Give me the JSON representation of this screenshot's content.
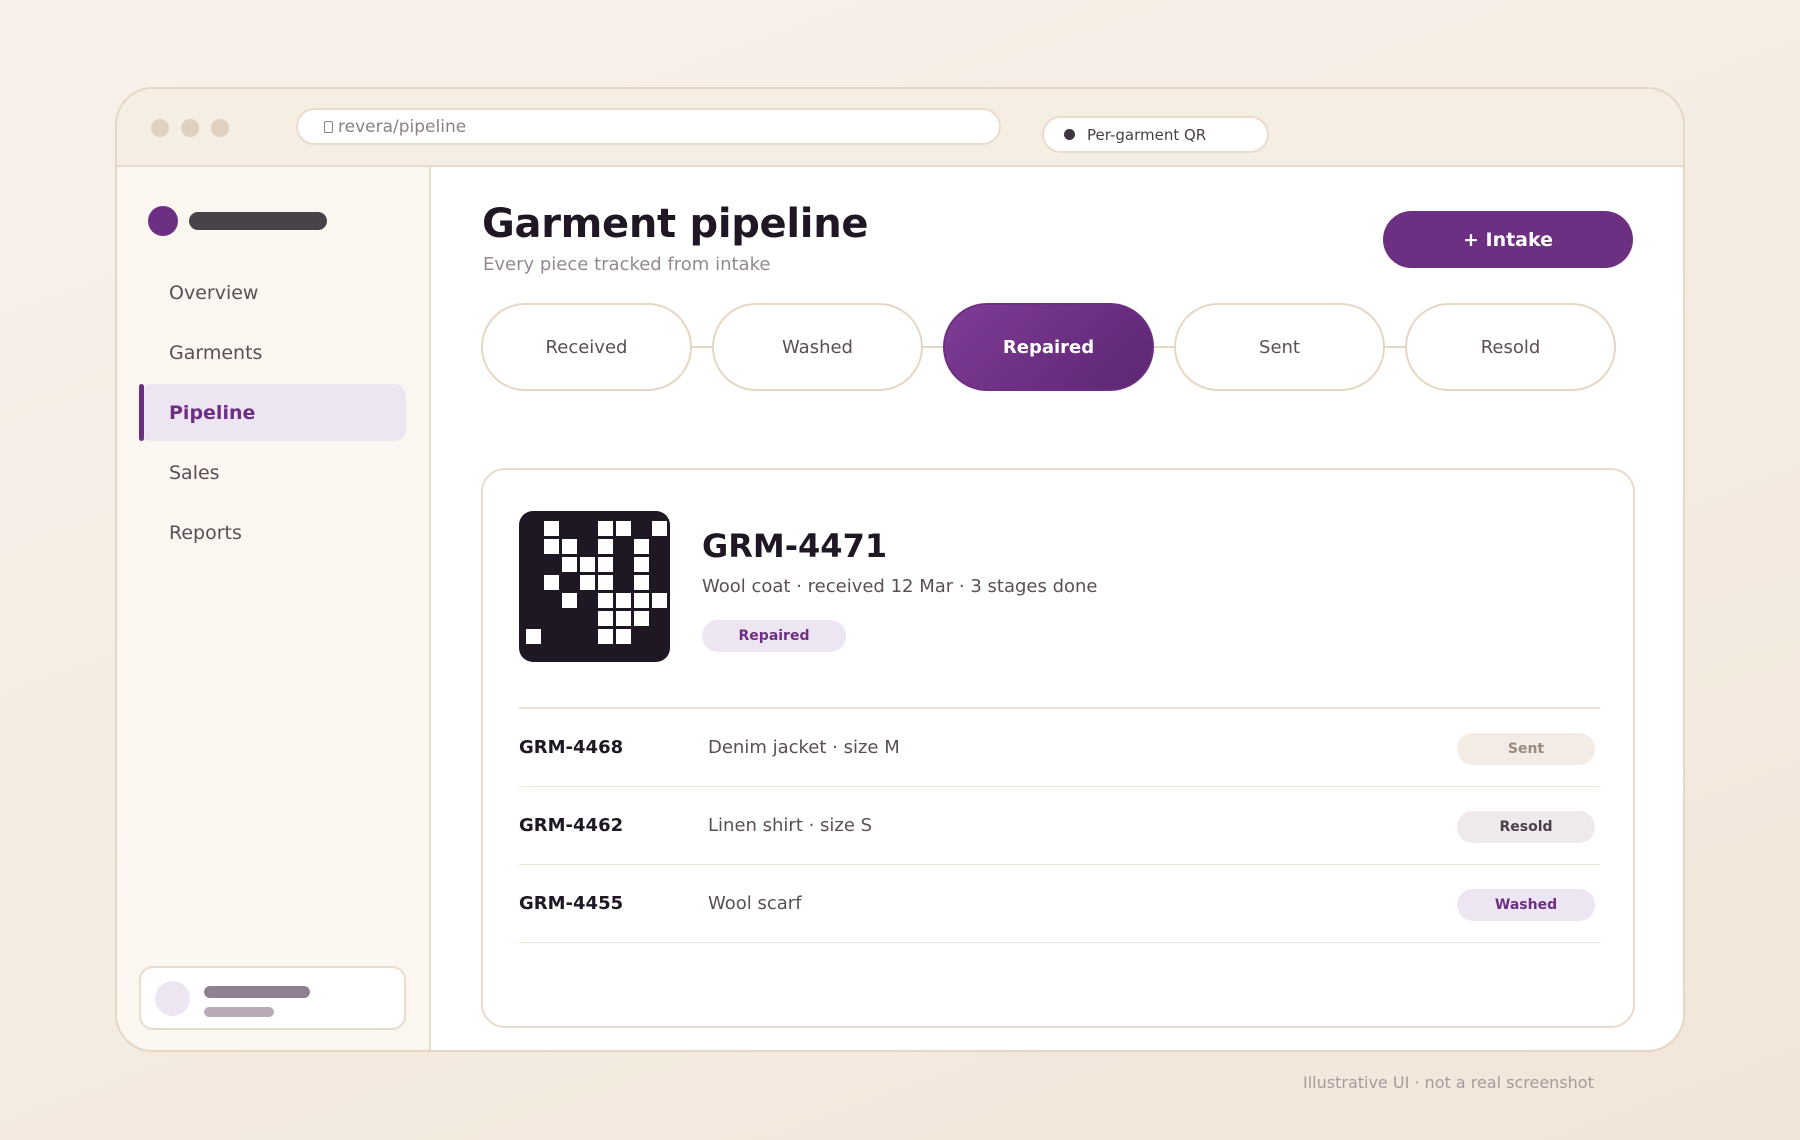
{
  "browser": {
    "url": "revera/pipeline",
    "qr_badge": "Per-garment QR"
  },
  "sidebar": {
    "items": [
      {
        "label": "Overview",
        "active": false
      },
      {
        "label": "Garments",
        "active": false
      },
      {
        "label": "Pipeline",
        "active": true
      },
      {
        "label": "Sales",
        "active": false
      },
      {
        "label": "Reports",
        "active": false
      }
    ]
  },
  "header": {
    "title": "Garment pipeline",
    "subtitle": "Every piece tracked from intake",
    "intake_label": "+ Intake"
  },
  "stages": [
    {
      "label": "Received",
      "active": false
    },
    {
      "label": "Washed",
      "active": false
    },
    {
      "label": "Repaired",
      "active": true
    },
    {
      "label": "Sent",
      "active": false
    },
    {
      "label": "Resold",
      "active": false
    }
  ],
  "detail": {
    "id": "GRM-4471",
    "meta": "Wool coat · received 12 Mar · 3 stages done",
    "stage": "Repaired"
  },
  "rows": [
    {
      "id": "GRM-4468",
      "desc": "Denim jacket · size M",
      "stage": "Sent"
    },
    {
      "id": "GRM-4462",
      "desc": "Linen shirt · size S",
      "stage": "Resold"
    },
    {
      "id": "GRM-4455",
      "desc": "Wool scarf",
      "stage": "Washed"
    }
  ],
  "colors": {
    "accent": "#6c2f82",
    "accent_soft": "#eee5f3",
    "border": "#eadccc"
  },
  "footnote": "Illustrative UI · not a real screenshot"
}
